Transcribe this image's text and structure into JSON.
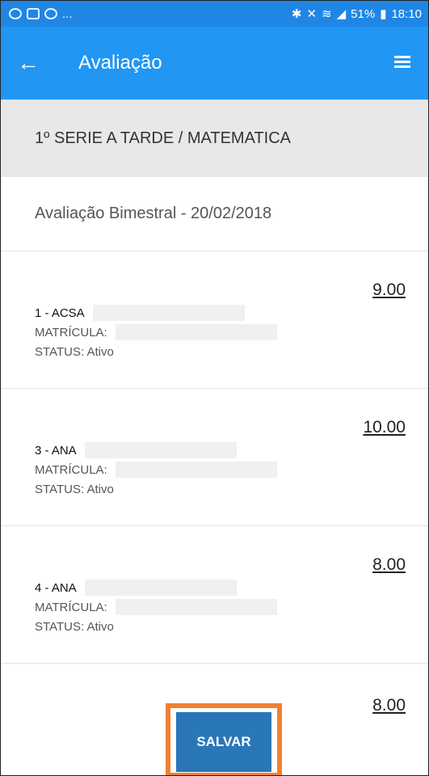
{
  "status_bar": {
    "left_icons": [
      "whatsapp-icon",
      "gallery-icon",
      "messenger-icon"
    ],
    "ellipsis": "...",
    "right_text": "51%",
    "time": "18:10"
  },
  "appbar": {
    "title": "Avaliação",
    "back_icon": "arrow-left-icon",
    "menu_icon": "list-icon"
  },
  "class_header": "1º SERIE A  TARDE / MATEMATICA",
  "exam": "Avaliação Bimestral  - 20/02/2018",
  "students": [
    {
      "name": "1 - ACSA",
      "matricula_label": "MATRÍCULA:",
      "status": "STATUS: Ativo",
      "grade": "9.00"
    },
    {
      "name": "3 - ANA",
      "matricula_label": "MATRÍCULA:",
      "status": "STATUS: Ativo",
      "grade": "10.00"
    },
    {
      "name": "4 - ANA",
      "matricula_label": "MATRÍCULA:",
      "status": "STATUS: Ativo",
      "grade": "8.00"
    }
  ],
  "last_grade": "8.00",
  "save_button": "SALVAR",
  "colors": {
    "primary": "#2196f3",
    "statusbar": "#1f86e6",
    "button": "#2a77b8",
    "highlight": "#f08030"
  }
}
